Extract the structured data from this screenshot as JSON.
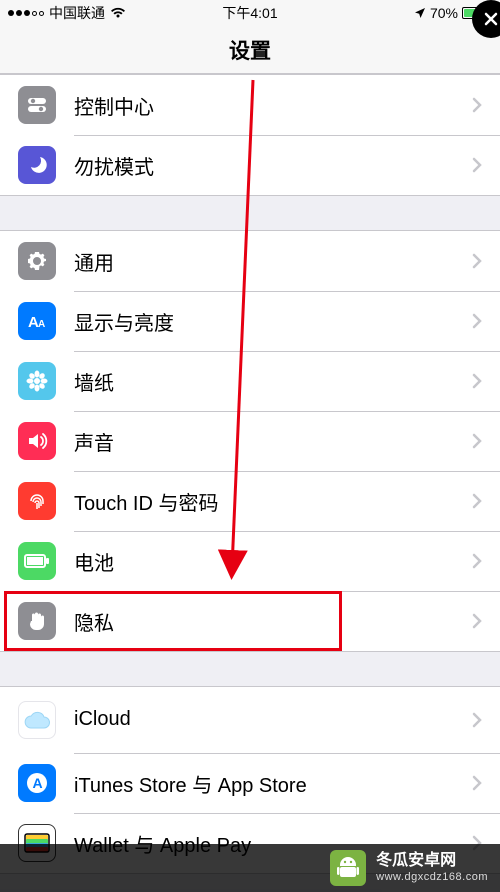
{
  "status": {
    "carrier": "中国联通",
    "time": "下午4:01",
    "battery_pct": "70%"
  },
  "nav": {
    "title": "设置"
  },
  "groups": [
    {
      "rows": [
        {
          "id": "control-center",
          "label": "控制中心",
          "icon": "toggles-icon",
          "bg": "bg-gray"
        },
        {
          "id": "dnd",
          "label": "勿扰模式",
          "icon": "moon-icon",
          "bg": "bg-purple"
        }
      ]
    },
    {
      "rows": [
        {
          "id": "general",
          "label": "通用",
          "icon": "gear-icon",
          "bg": "bg-gray"
        },
        {
          "id": "display",
          "label": "显示与亮度",
          "icon": "text-size-icon",
          "bg": "bg-blue"
        },
        {
          "id": "wallpaper",
          "label": "墙纸",
          "icon": "flower-icon",
          "bg": "bg-teal"
        },
        {
          "id": "sounds",
          "label": "声音",
          "icon": "speaker-icon",
          "bg": "bg-red2"
        },
        {
          "id": "touchid",
          "label": "Touch ID 与密码",
          "icon": "fingerprint-icon",
          "bg": "bg-red"
        },
        {
          "id": "battery",
          "label": "电池",
          "icon": "battery-icon",
          "bg": "bg-green"
        },
        {
          "id": "privacy",
          "label": "隐私",
          "icon": "hand-icon",
          "bg": "bg-gray"
        }
      ]
    },
    {
      "rows": [
        {
          "id": "icloud",
          "label": "iCloud",
          "sub": "",
          "icon": "cloud-icon",
          "bg": "bg-white"
        },
        {
          "id": "itunes",
          "label": "iTunes Store 与 App Store",
          "icon": "appstore-icon",
          "bg": "bg-blue"
        },
        {
          "id": "wallet",
          "label": "Wallet 与 Apple Pay",
          "icon": "wallet-icon",
          "bg": "bg-white"
        }
      ]
    }
  ],
  "watermark": {
    "line1": "冬瓜安卓网",
    "line2": "www.dgxcdz168.com"
  },
  "colors": {
    "highlight": "#e60012"
  }
}
